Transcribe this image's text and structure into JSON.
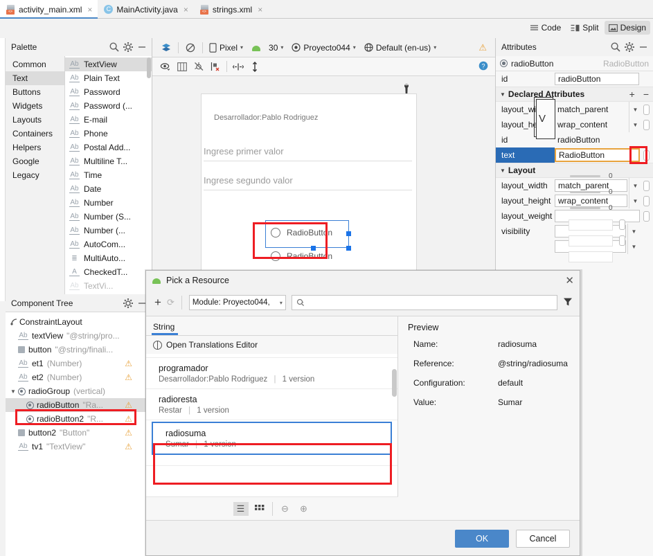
{
  "tabs": [
    {
      "label": "activity_main.xml",
      "icon": "xml-file-icon",
      "active": true
    },
    {
      "label": "MainActivity.java",
      "icon": "java-file-icon",
      "active": false
    },
    {
      "label": "strings.xml",
      "icon": "xml-file-icon",
      "active": false
    }
  ],
  "close_glyph": "×",
  "editor_modes": [
    {
      "label": "Code",
      "icon": "code-view-icon",
      "active": false
    },
    {
      "label": "Split",
      "icon": "split-view-icon",
      "active": false
    },
    {
      "label": "Design",
      "icon": "design-view-icon",
      "active": true
    }
  ],
  "palette": {
    "title": "Palette",
    "icons": [
      "search-icon",
      "gear-icon",
      "minimize-icon"
    ],
    "categories": [
      {
        "label": "Common",
        "selected": false
      },
      {
        "label": "Text",
        "selected": true
      },
      {
        "label": "Buttons",
        "selected": false
      },
      {
        "label": "Widgets",
        "selected": false
      },
      {
        "label": "Layouts",
        "selected": false
      },
      {
        "label": "Containers",
        "selected": false
      },
      {
        "label": "Helpers",
        "selected": false
      },
      {
        "label": "Google",
        "selected": false
      },
      {
        "label": "Legacy",
        "selected": false
      }
    ],
    "items": [
      {
        "label": "TextView",
        "glyph": "Ab",
        "selected": true
      },
      {
        "label": "Plain Text",
        "glyph": "Ab",
        "selected": false
      },
      {
        "label": "Password",
        "glyph": "Ab",
        "selected": false
      },
      {
        "label": "Password (...",
        "glyph": "Ab",
        "selected": false
      },
      {
        "label": "E-mail",
        "glyph": "Ab",
        "selected": false
      },
      {
        "label": "Phone",
        "glyph": "Ab",
        "selected": false
      },
      {
        "label": "Postal Add...",
        "glyph": "Ab",
        "selected": false
      },
      {
        "label": "Multiline T...",
        "glyph": "Ab",
        "selected": false
      },
      {
        "label": "Time",
        "glyph": "Ab",
        "selected": false
      },
      {
        "label": "Date",
        "glyph": "Ab",
        "selected": false
      },
      {
        "label": "Number",
        "glyph": "Ab",
        "selected": false
      },
      {
        "label": "Number (S...",
        "glyph": "Ab",
        "selected": false
      },
      {
        "label": "Number (...",
        "glyph": "Ab",
        "selected": false
      },
      {
        "label": "AutoCom...",
        "glyph": "Ab",
        "selected": false
      },
      {
        "label": "MultiAuto...",
        "glyph": "≣",
        "selected": false
      },
      {
        "label": "CheckedT...",
        "glyph": "A",
        "selected": false
      },
      {
        "label": "TextVi...",
        "glyph": "Ab",
        "selected": false
      }
    ]
  },
  "component_tree": {
    "title": "Component Tree",
    "icons": [
      "gear-icon",
      "minimize-icon"
    ],
    "nodes": [
      {
        "name": "ConstraintLayout",
        "sub": "",
        "icon": "constraint-layout-icon",
        "indent": 0,
        "warn": false,
        "selected": false,
        "expander": ""
      },
      {
        "name": "textView",
        "sub": "\"@string/pro...",
        "icon": "textview-icon",
        "indent": 1,
        "warn": false,
        "selected": false,
        "expander": ""
      },
      {
        "name": "button",
        "sub": "\"@string/finali...",
        "icon": "button-icon",
        "indent": 1,
        "warn": false,
        "selected": false,
        "expander": ""
      },
      {
        "name": "et1",
        "sub": "(Number)",
        "icon": "textview-icon",
        "indent": 1,
        "warn": true,
        "selected": false,
        "expander": ""
      },
      {
        "name": "et2",
        "sub": "(Number)",
        "icon": "textview-icon",
        "indent": 1,
        "warn": true,
        "selected": false,
        "expander": ""
      },
      {
        "name": "radioGroup",
        "sub": "(vertical)",
        "icon": "radio-group-icon",
        "indent": 1,
        "warn": false,
        "selected": false,
        "expander": "▼"
      },
      {
        "name": "radioButton",
        "sub": "\"Ra...",
        "icon": "radio-icon",
        "indent": 2,
        "warn": true,
        "selected": true,
        "expander": ""
      },
      {
        "name": "radioButton2",
        "sub": "\"R...",
        "icon": "radio-icon",
        "indent": 2,
        "warn": true,
        "selected": false,
        "expander": ""
      },
      {
        "name": "button2",
        "sub": "\"Button\"",
        "icon": "button-icon",
        "indent": 1,
        "warn": true,
        "selected": false,
        "expander": ""
      },
      {
        "name": "tv1",
        "sub": "\"TextView\"",
        "icon": "textview-icon",
        "indent": 1,
        "warn": true,
        "selected": false,
        "expander": ""
      }
    ]
  },
  "design_toolbar": {
    "layers_icon": "layers-icon",
    "blueprint_icon": "blueprint-toggle-icon",
    "device": "Pixel",
    "api": "30",
    "theme": "Proyecto044",
    "locale": "Default (en-us)",
    "warning_icon": "warning-icon",
    "caret": "▾"
  },
  "design_toolbar2": {
    "icons": [
      "eye-visibility-icon",
      "guidelines-icon",
      "hide-constraints-icon",
      "clear-constraints-icon",
      "align-horizontal-icon",
      "expand-vertical-icon"
    ],
    "help_icon": "help-icon"
  },
  "preview": {
    "wrench_icon": "wrench-icon",
    "developer_text": "Desarrollador:Pablo Rodriguez",
    "field1_hint": "Ingrese primer valor",
    "field2_hint": "Ingrese segundo valor",
    "radio1_label": "RadioButton",
    "radio2_label": "RadioButton"
  },
  "attributes": {
    "title": "Attributes",
    "icons": [
      "search-icon",
      "gear-icon",
      "minimize-icon"
    ],
    "selected_id": "radioButton",
    "selected_type": "RadioButton",
    "id_label": "id",
    "id_value": "radioButton",
    "declared_section": "Declared Attributes",
    "add_glyph": "+",
    "remove_glyph": "−",
    "declared": [
      {
        "label": "layout_width",
        "value": "match_parent",
        "dropdown": true,
        "pill": true,
        "selected": false
      },
      {
        "label": "layout_height",
        "value": "wrap_content",
        "dropdown": true,
        "pill": true,
        "selected": false
      },
      {
        "label": "id",
        "value": "radioButton",
        "dropdown": false,
        "pill": false,
        "selected": false
      },
      {
        "label": "text",
        "value": "RadioButton",
        "dropdown": false,
        "pill": true,
        "selected": true,
        "highlighted": true
      }
    ],
    "layout_section": "Layout",
    "layout": [
      {
        "label": "layout_width",
        "value": "match_parent",
        "dropdown": true,
        "pill": true
      },
      {
        "label": "layout_height",
        "value": "wrap_content",
        "dropdown": true,
        "pill": true
      },
      {
        "label": "layout_weight",
        "value": "",
        "dropdown": false,
        "pill": true
      },
      {
        "label": "visibility",
        "value": "",
        "dropdown": true,
        "pill": false
      },
      {
        "label": "",
        "value": "",
        "dropdown": true,
        "pill": false
      }
    ],
    "constraint_values": [
      "0",
      "0",
      "0"
    ],
    "constraint_letter": "V"
  },
  "dialog": {
    "title": "Pick a Resource",
    "icon": "android-icon",
    "close_glyph": "✕",
    "add_glyph": "+",
    "refresh_glyph": "⟳",
    "module_label": "Module: Proyecto044,",
    "module_caret": "▾",
    "search_placeholder": "",
    "search_icon": "search-icon",
    "filter_icon": "filter-funnel-icon",
    "tab_label": "String",
    "translations_label": "Open Translations Editor",
    "translations_icon": "globe-icon",
    "resources": [
      {
        "name": "programador",
        "value": "Desarrollador:Pablo Rodriguez",
        "versions": "1 version",
        "selected": false
      },
      {
        "name": "radioresta",
        "value": "Restar",
        "versions": "1 version",
        "selected": false
      },
      {
        "name": "radiosuma",
        "value": "Sumar",
        "versions": "1 version",
        "selected": true
      }
    ],
    "meta_sep": "|",
    "preview": {
      "header": "Preview",
      "rows": [
        {
          "key": "Name:",
          "value": "radiosuma"
        },
        {
          "key": "Reference:",
          "value": "@string/radiosuma"
        },
        {
          "key": "Configuration:",
          "value": "default"
        },
        {
          "key": "Value:",
          "value": "Sumar"
        }
      ]
    },
    "view_buttons": [
      {
        "icon": "list-view-icon",
        "glyph": "☰",
        "active": true
      },
      {
        "icon": "grid-view-icon",
        "glyph": "☷",
        "active": false
      },
      {
        "icon": "zoom-out-icon",
        "glyph": "⊖",
        "active": false
      },
      {
        "icon": "zoom-in-icon",
        "glyph": "⊕",
        "active": false
      }
    ],
    "ok_label": "OK",
    "cancel_label": "Cancel"
  },
  "colors": {
    "accent_blue": "#3a7fd5",
    "primary_button": "#4a87c9",
    "highlight_red": "#ee1d23",
    "highlight_orange": "#e8a33d",
    "selection_blue": "#2a6bb5",
    "warning_yellow": "#e8a33d"
  }
}
